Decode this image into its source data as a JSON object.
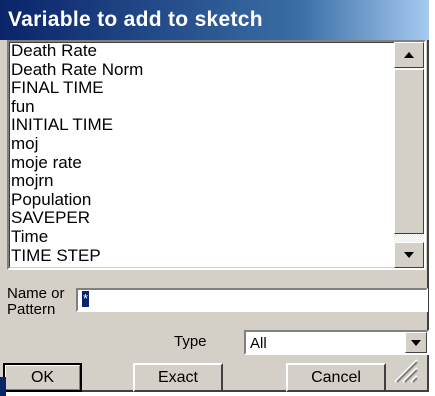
{
  "dialog": {
    "title": "Variable to add to sketch",
    "list": {
      "items": [
        "Death Rate",
        "Death Rate Norm",
        "FINAL TIME",
        "fun",
        "INITIAL TIME",
        "moj",
        "moje rate",
        "mojrn",
        "Population",
        "SAVEPER",
        "Time",
        "TIME STEP"
      ],
      "highlighted_item": "Time",
      "highlight_color": "#ffff33"
    },
    "name_label": "Name or Pattern",
    "name_value": "*",
    "type_label": "Type",
    "type_value": "All",
    "buttons": {
      "ok": "OK",
      "exact": "Exact",
      "cancel": "Cancel"
    },
    "icons": {
      "scroll_up": "up-arrow-icon",
      "scroll_down": "down-arrow-icon",
      "dropdown": "chevron-down-icon",
      "resize": "resize-grip-icon"
    },
    "colors": {
      "title_bar": "#0a246a",
      "face": "#d4d0c8"
    }
  }
}
